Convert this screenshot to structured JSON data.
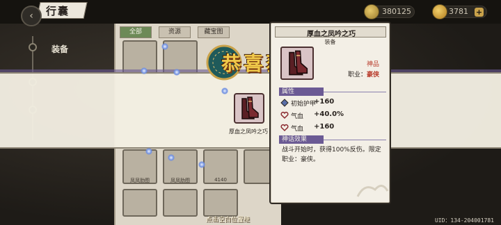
{
  "header": {
    "title": "行囊",
    "currency_1": "380125",
    "currency_2": "3781",
    "plus": "+"
  },
  "menu": {
    "items": [
      {
        "label": "装备"
      },
      {
        "label": ""
      },
      {
        "label": ""
      }
    ]
  },
  "panel": {
    "tabs": [
      "全部",
      "资源",
      "藏宝图"
    ],
    "row1_labels": [
      "",
      "",
      "",
      ""
    ],
    "row2_labels": [
      "凤凤肋图",
      "凤凤肋图",
      "4140",
      ""
    ]
  },
  "banner": {
    "congrats": "恭喜获",
    "reward_label": "厚血之凤吟之巧"
  },
  "tooltip": {
    "name": "厚血之凤吟之巧",
    "type": "装备",
    "quality": "神品",
    "class_prefix": "职业：",
    "class_value": "豪侠",
    "attributes_title": "属性",
    "stats": [
      {
        "label": "初始护甲",
        "value": "+160",
        "icon": "armor-icon"
      },
      {
        "label": "气血",
        "value": "+40.0%",
        "icon": "heart-icon"
      },
      {
        "label": "气血",
        "value": "+160",
        "icon": "heart-icon"
      }
    ],
    "effect_title": "神话效果",
    "effect_text": "战斗开始时，获得100%反伤。限定职业：豪侠。"
  },
  "footer": {
    "hint": "点击空白位置继",
    "uid": "UID：134-204001781"
  },
  "colors": {
    "accent_purple": "#6b5a94",
    "quality_red": "#b83a2a",
    "gold": "#f0c94a"
  }
}
